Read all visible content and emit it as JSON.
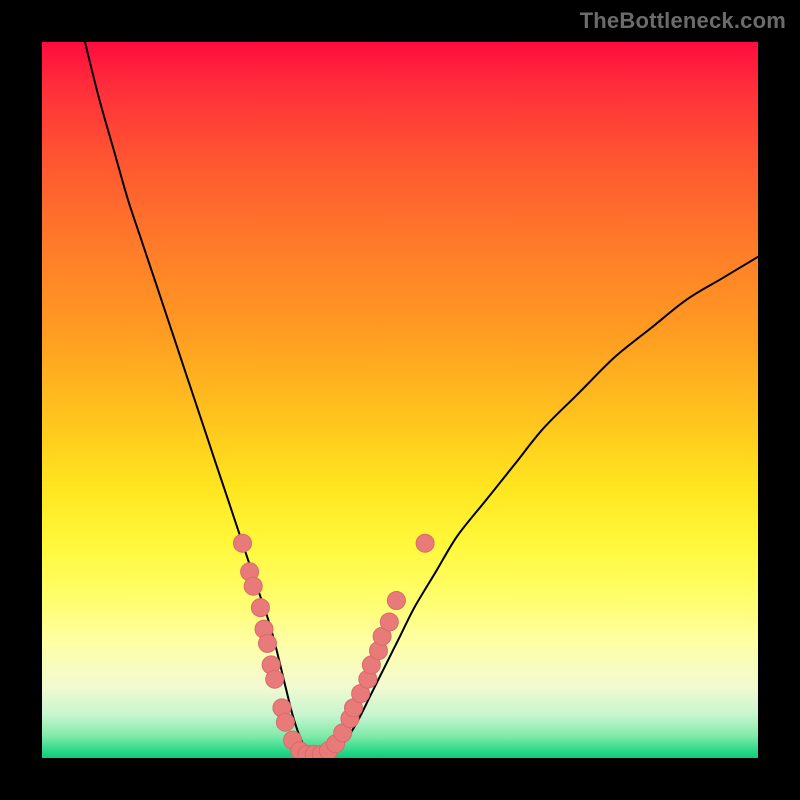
{
  "watermark": "TheBottleneck.com",
  "colors": {
    "curve": "#000000",
    "marker_fill": "#e97a7a",
    "marker_stroke": "#d86a6a"
  },
  "chart_data": {
    "type": "line",
    "title": "",
    "xlabel": "",
    "ylabel": "",
    "xlim": [
      0,
      100
    ],
    "ylim": [
      0,
      100
    ],
    "grid": false,
    "series": [
      {
        "name": "curve",
        "x": [
          6,
          8,
          10,
          12,
          14,
          16,
          18,
          20,
          22,
          24,
          26,
          28,
          30,
          32,
          34,
          35,
          36,
          37,
          38,
          40,
          42,
          44,
          46,
          48,
          50,
          52,
          55,
          58,
          62,
          66,
          70,
          75,
          80,
          85,
          90,
          95,
          100
        ],
        "y": [
          100,
          92,
          85,
          78,
          72,
          66,
          60,
          54,
          48,
          42,
          36,
          30,
          24,
          18,
          10,
          6,
          3,
          1,
          0.5,
          0.5,
          2,
          5,
          9,
          13,
          17,
          21,
          26,
          31,
          36,
          41,
          46,
          51,
          56,
          60,
          64,
          67,
          70
        ]
      }
    ],
    "markers": [
      {
        "x": 28,
        "y": 30
      },
      {
        "x": 29,
        "y": 26
      },
      {
        "x": 29.5,
        "y": 24
      },
      {
        "x": 30.5,
        "y": 21
      },
      {
        "x": 31,
        "y": 18
      },
      {
        "x": 31.5,
        "y": 16
      },
      {
        "x": 32,
        "y": 13
      },
      {
        "x": 32.5,
        "y": 11
      },
      {
        "x": 33.5,
        "y": 7
      },
      {
        "x": 34,
        "y": 5
      },
      {
        "x": 35,
        "y": 2.5
      },
      {
        "x": 36,
        "y": 1
      },
      {
        "x": 37,
        "y": 0.5
      },
      {
        "x": 38,
        "y": 0.5
      },
      {
        "x": 39,
        "y": 0.5
      },
      {
        "x": 40,
        "y": 1
      },
      {
        "x": 41,
        "y": 2
      },
      {
        "x": 42,
        "y": 3.5
      },
      {
        "x": 43,
        "y": 5.5
      },
      {
        "x": 43.5,
        "y": 7
      },
      {
        "x": 44.5,
        "y": 9
      },
      {
        "x": 45.5,
        "y": 11
      },
      {
        "x": 46,
        "y": 13
      },
      {
        "x": 47,
        "y": 15
      },
      {
        "x": 47.5,
        "y": 17
      },
      {
        "x": 48.5,
        "y": 19
      },
      {
        "x": 49.5,
        "y": 22
      },
      {
        "x": 53.5,
        "y": 30
      }
    ]
  }
}
